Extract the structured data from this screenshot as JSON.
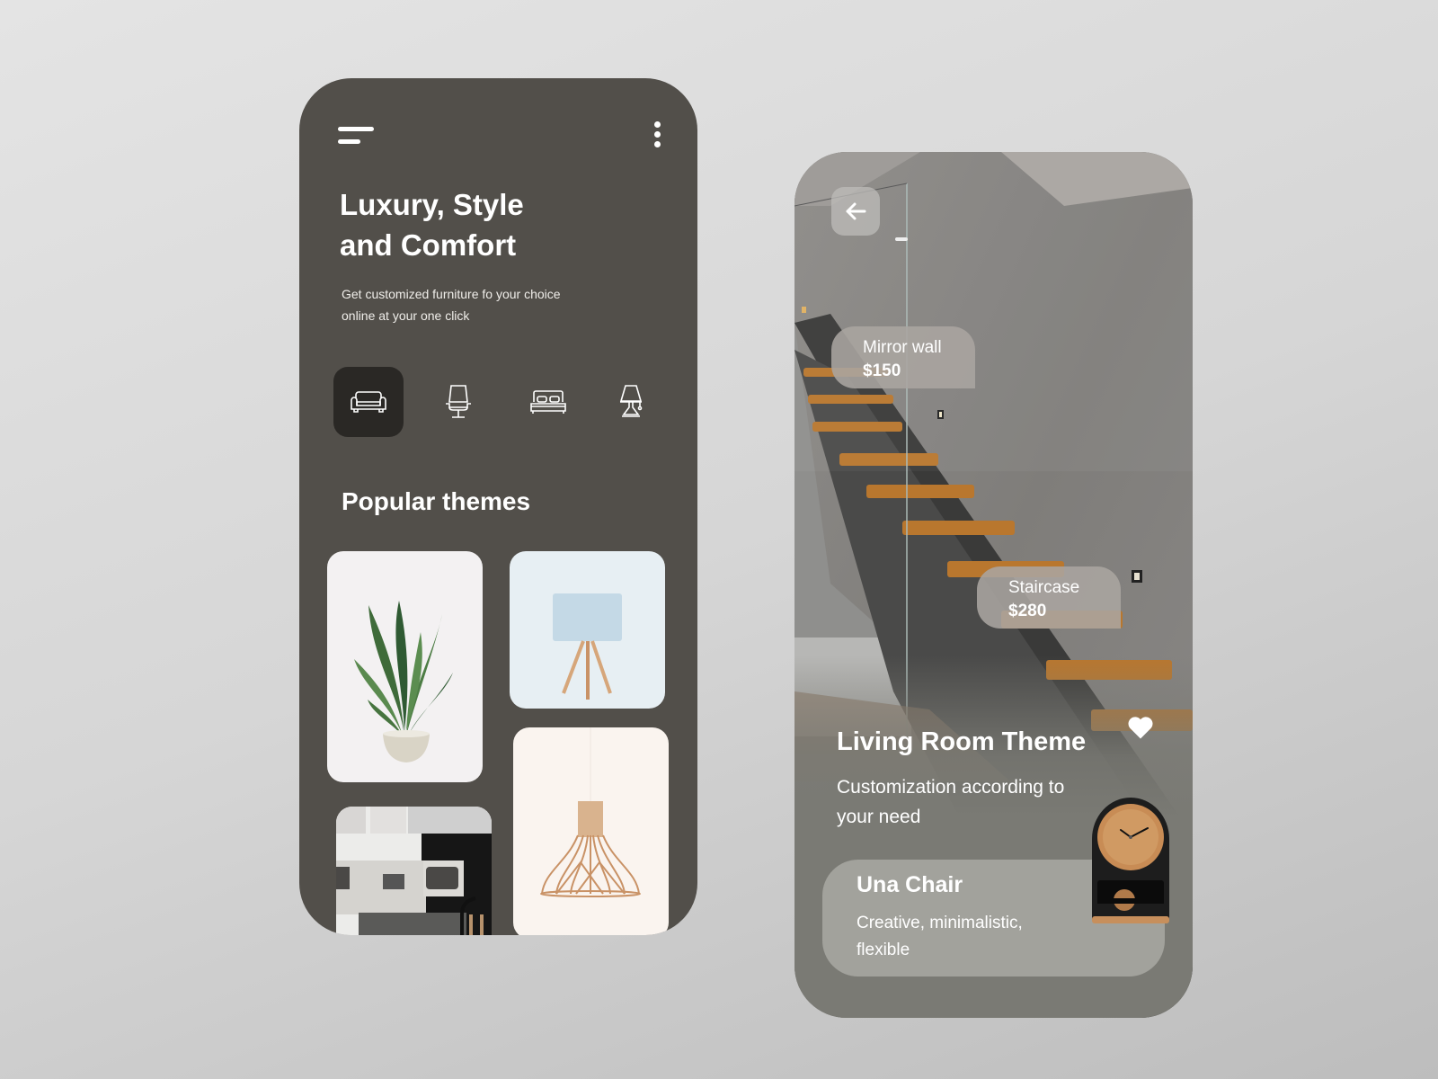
{
  "left_screen": {
    "header": {
      "menu_icon": "hamburger-menu-icon",
      "more_icon": "vertical-dots-icon"
    },
    "hero": {
      "title_line1": "Luxury, Style",
      "title_line2": "and Comfort",
      "subtitle_line1": "Get customized furniture fo your choice",
      "subtitle_line2": "online at your one click"
    },
    "categories": [
      {
        "name": "Sofa",
        "icon": "sofa-icon",
        "active": true
      },
      {
        "name": "Chair",
        "icon": "chair-icon",
        "active": false
      },
      {
        "name": "Bed",
        "icon": "bed-icon",
        "active": false
      },
      {
        "name": "Lamp",
        "icon": "lamp-icon",
        "active": false
      }
    ],
    "popular": {
      "title": "Popular themes",
      "tiles": [
        {
          "name": "Potted plant"
        },
        {
          "name": "Tripod table lamp"
        },
        {
          "name": "Living room interior"
        },
        {
          "name": "Wooden pendant lamp"
        }
      ]
    }
  },
  "right_screen": {
    "back_icon": "arrow-left-icon",
    "tags": [
      {
        "name": "Mirror wall",
        "price": "$150"
      },
      {
        "name": "Staircase",
        "price": "$280"
      }
    ],
    "favorite_icon": "heart-icon",
    "theme": {
      "title": "Living Room Theme",
      "subtitle_line1": "Customization according to",
      "subtitle_line2": "your need"
    },
    "product": {
      "name": "Una Chair",
      "desc_line1": "Creative, minimalistic,",
      "desc_line2": "flexible"
    }
  },
  "colors": {
    "left_bg": "#524f4a",
    "active_category": "#2a2825",
    "right_card": "#7a7a74",
    "product_card": "#a2a29c",
    "tag_bg": "#aaa5a0"
  }
}
